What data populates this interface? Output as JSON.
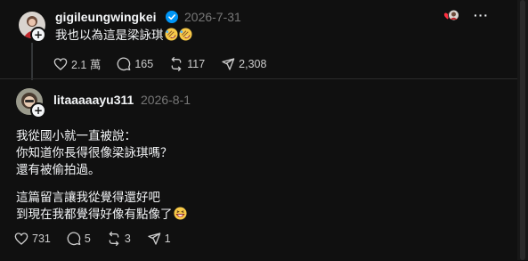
{
  "posts": [
    {
      "username": "gigileungwingkei",
      "verified": true,
      "timestamp": "2026-7-31",
      "text_lines": [
        "我也以為這是梁詠琪"
      ],
      "emoji_icons": [
        "rolling-on-floor-laughing-emoji",
        "rolling-on-floor-laughing-emoji"
      ],
      "actions": {
        "likes": "2.1 萬",
        "comments": "165",
        "reposts": "117",
        "shares": "2,308"
      },
      "liked_by_author_icon": "heart-with-avatar-icon"
    },
    {
      "username": "litaaaaayu311",
      "verified": false,
      "timestamp": "2026-8-1",
      "text_lines": [
        "我從國小就一直被說：",
        "你知道你長得很像梁詠琪嗎？",
        "還有被偷拍過。",
        "",
        "這篇留言讓我從覺得還好吧",
        "到現在我都覺得好像有點像了"
      ],
      "emoji_icons": [
        "grinning-squinting-emoji"
      ],
      "actions": {
        "likes": "731",
        "comments": "5",
        "reposts": "3",
        "shares": "1"
      }
    }
  ],
  "colors": {
    "background": "#101010",
    "text": "#f3f5f7",
    "muted": "#777777",
    "verified": "#0095f6",
    "heart": "#ff3040"
  }
}
